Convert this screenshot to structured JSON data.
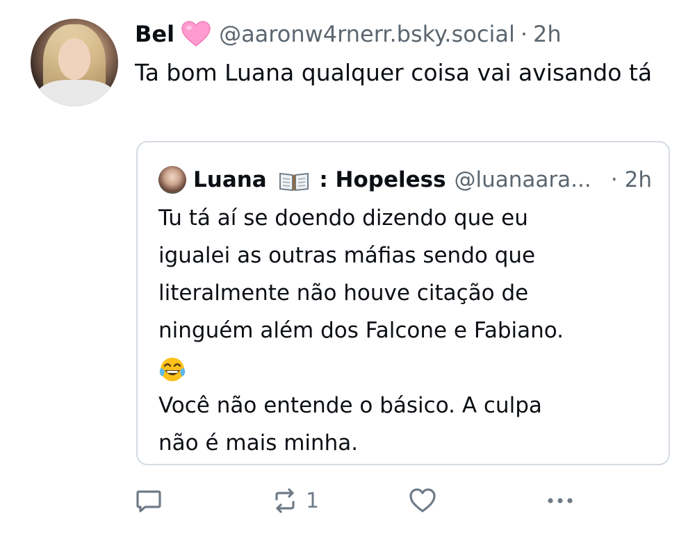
{
  "post": {
    "author_name": "Bel",
    "handle": "@aaronw4rnerr.bsky.social",
    "separator": "·",
    "time": "2h",
    "text": "Ta bom Luana qualquer coisa vai avisando tá",
    "icons": {
      "name_badge": "pink-heart-icon",
      "avatar": "avatar-image"
    }
  },
  "quote": {
    "author_name": "Luana",
    "name_suffix": ": Hopeless",
    "handle": "@luanaara...",
    "separator": "·",
    "time": "2h",
    "lines": [
      "Tu tá aí se doendo dizendo que eu",
      "igualei as outras máfias sendo que",
      "literalmente não houve citação de",
      "ninguém além dos Falcone e Fabiano.",
      "Você não entende o básico. A culpa",
      "não é mais minha."
    ],
    "icons": {
      "name_badge": "open-book-icon",
      "emoji": "tears-of-joy-emoji"
    }
  },
  "actions": {
    "reply_count": "",
    "repost_count": "1",
    "like_count": "",
    "icons": [
      "reply-icon",
      "repost-icon",
      "like-icon",
      "more-icon"
    ]
  },
  "colors": {
    "text": "#0b0f14",
    "muted": "#5b6670",
    "border": "#d4dbe2",
    "heart": "#ff9ccf",
    "action": "#6e7b87"
  }
}
